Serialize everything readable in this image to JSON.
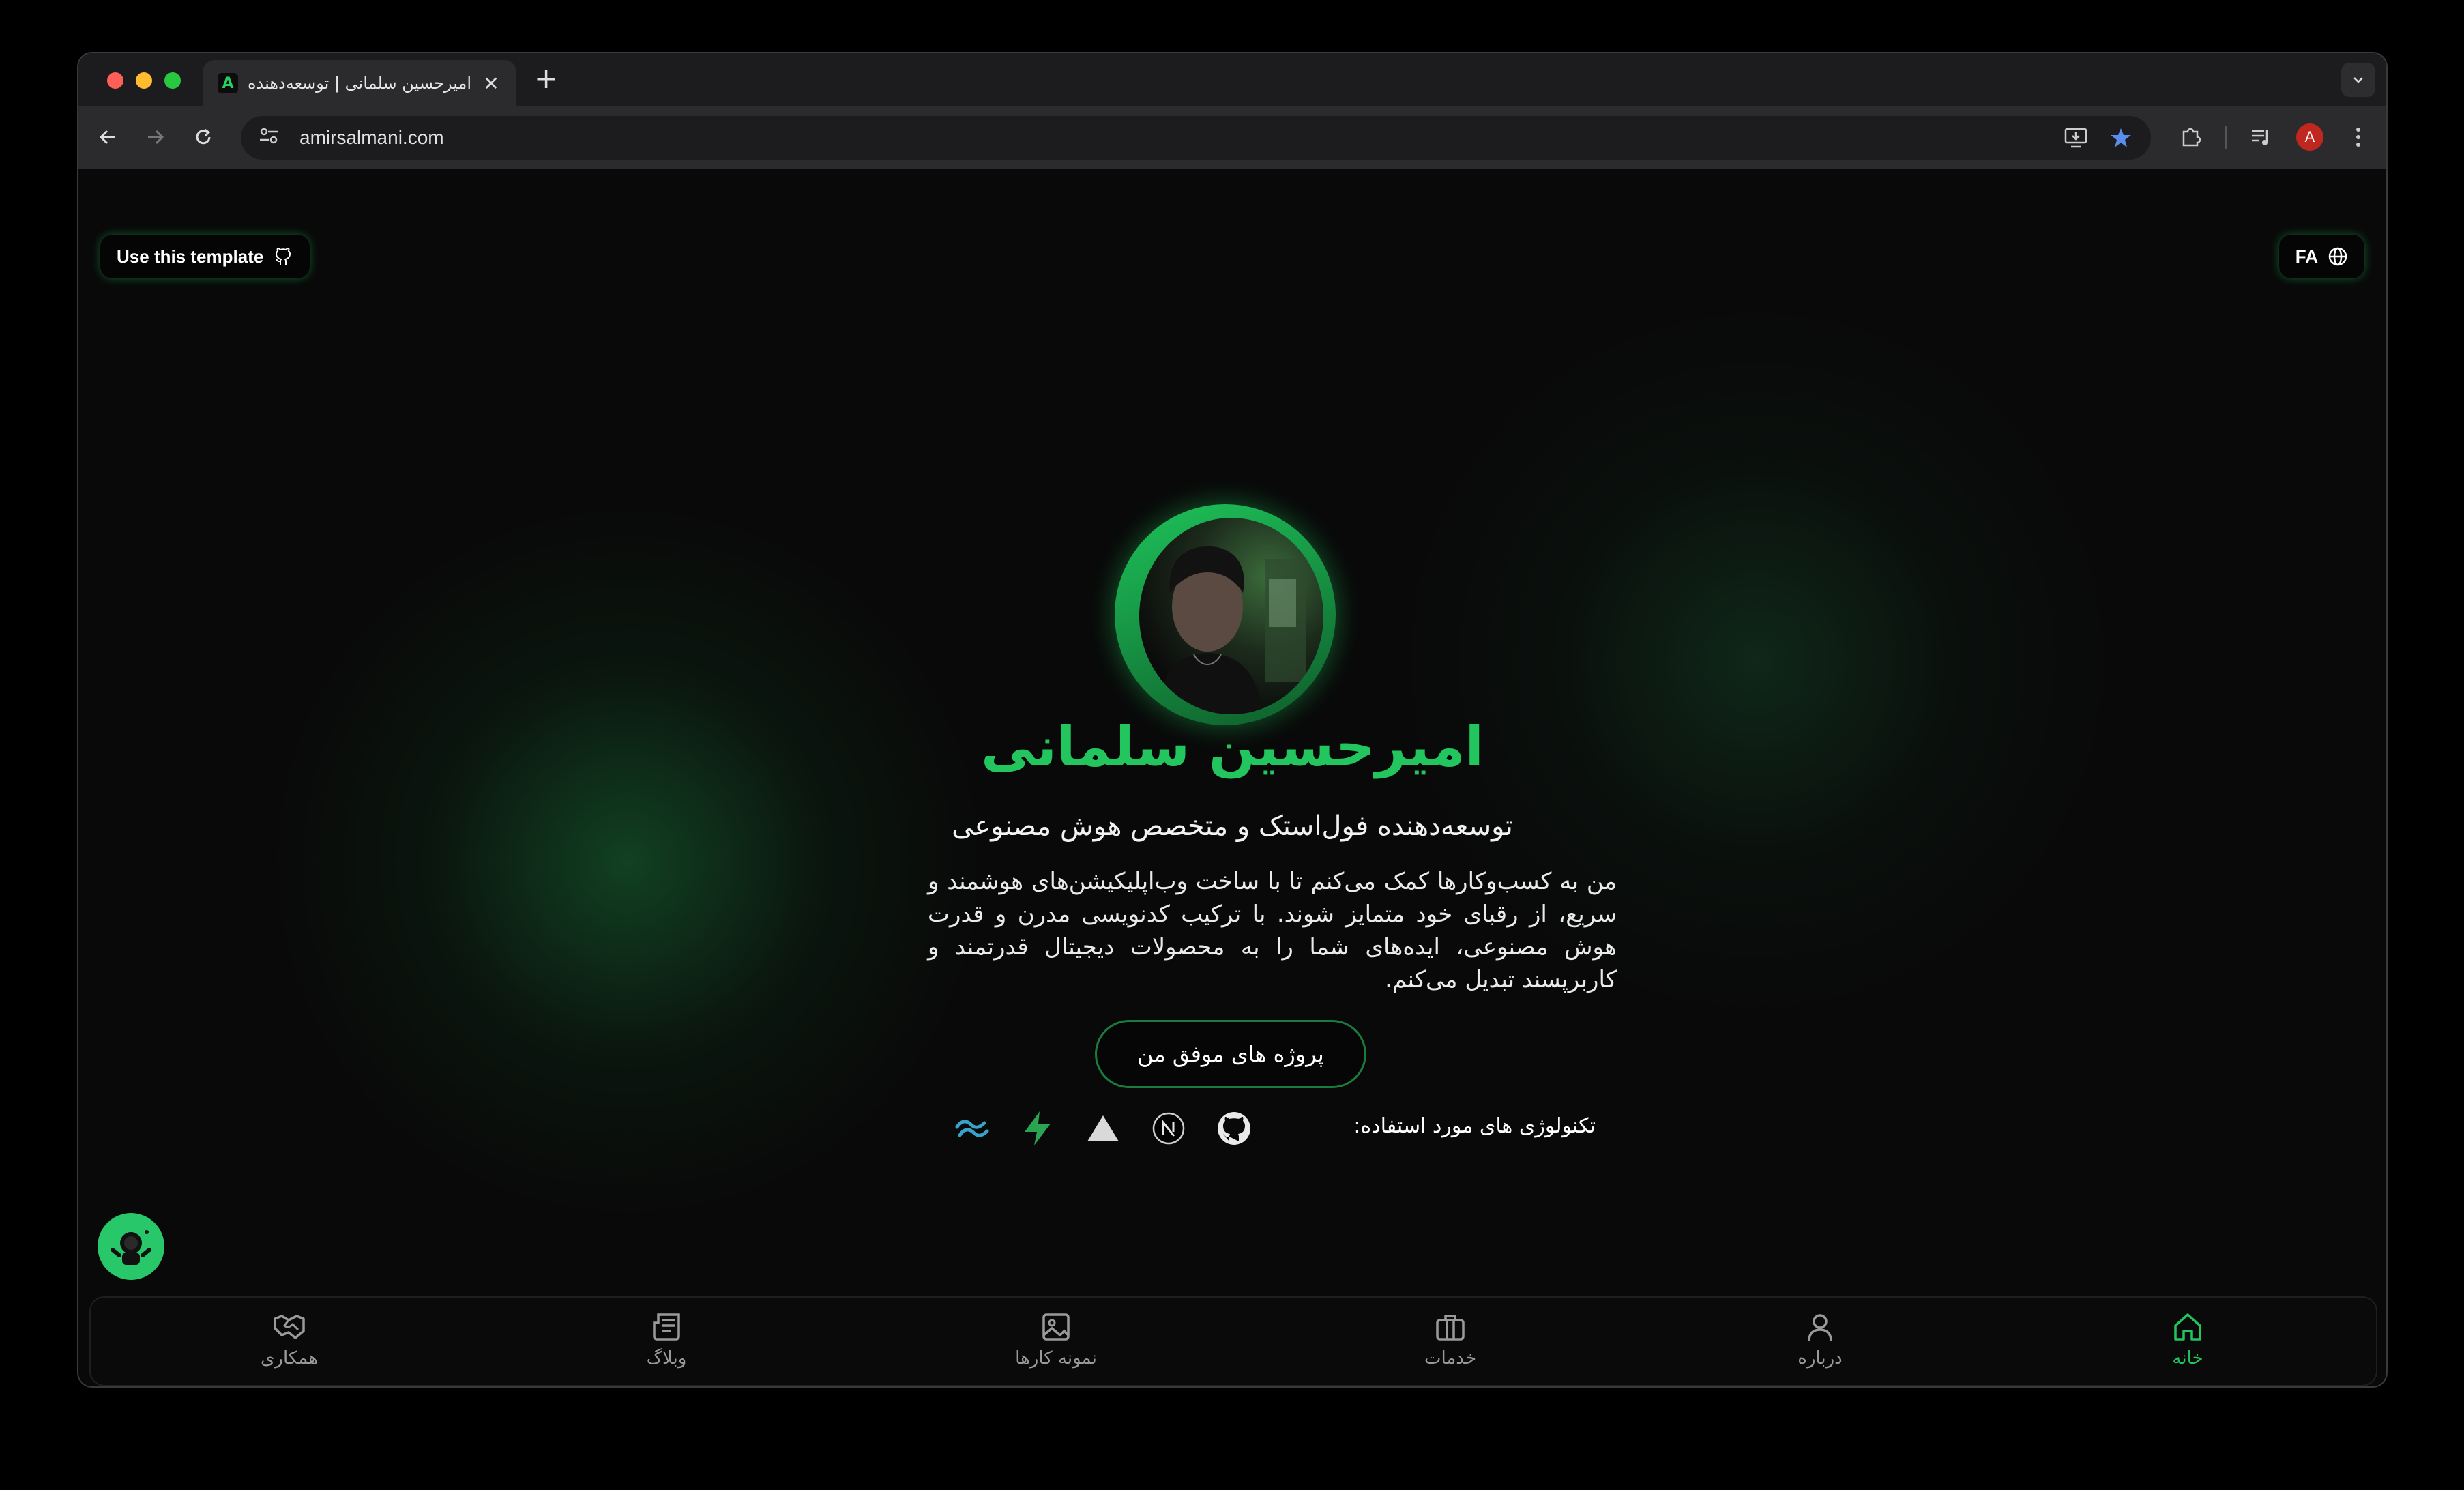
{
  "browser": {
    "tab_favicon": "A",
    "tab_title": "امیرحسین سلمانی | توسعه‌دهنده فول‌استک",
    "url": "amirsalmani.com",
    "profile_initial": "A",
    "colors": {
      "close": "#ff5f57",
      "minimize": "#febc2e",
      "zoom": "#28c840",
      "star": "#5b8def"
    }
  },
  "header": {
    "template_button": "Use this template",
    "language_button": "FA"
  },
  "hero": {
    "name": "امیرحسین سلمانی",
    "subtitle": "توسعه‌دهنده فول‌استک و متخصص هوش مصنوعی",
    "bio": "من به کسب‌وکارها کمک می‌کنم تا با ساخت وب‌اپلیکیشن‌های هوشمند و سریع، از رقبای خود متمایز شوند. با ترکیب کدنویسی مدرن و قدرت هوش مصنوعی، ایده‌های شما را به محصولات دیجیتال قدرتمند و کاربرپسند تبدیل می‌کنم.",
    "cta": "پروژه های موفق من",
    "tech_label": "تکنولوژی های مورد استفاده:",
    "tech_icons": [
      "github-icon",
      "nextjs-icon",
      "vercel-icon",
      "supabase-icon",
      "tailwind-icon"
    ],
    "accent_color": "#22c55e"
  },
  "bottom_nav": {
    "items": [
      {
        "label": "خانه",
        "icon": "home-icon",
        "active": true
      },
      {
        "label": "درباره",
        "icon": "user-icon"
      },
      {
        "label": "خدمات",
        "icon": "briefcase-icon"
      },
      {
        "label": "نمونه کارها",
        "icon": "image-icon"
      },
      {
        "label": "وبلاگ",
        "icon": "newspaper-icon"
      },
      {
        "label": "همکاری",
        "icon": "handshake-icon"
      }
    ]
  }
}
